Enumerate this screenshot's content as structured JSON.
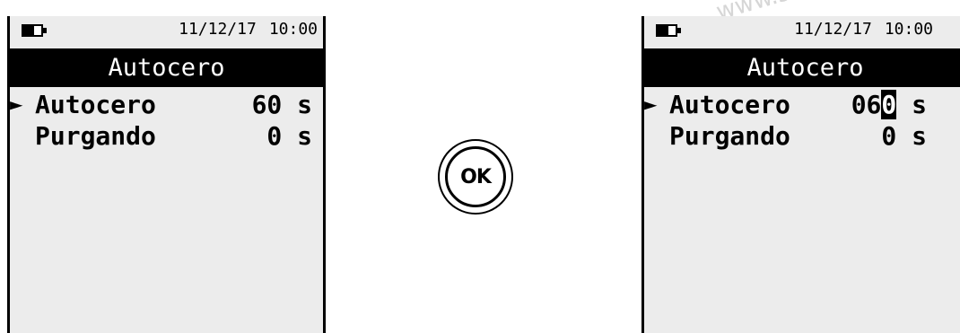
{
  "watermark": "www.s",
  "screens": {
    "left": {
      "battery_level": 0.6,
      "date": "11/12/17",
      "time": "10:00",
      "title": "Autocero",
      "cursor_glyph": "►",
      "items": [
        {
          "label": "Autocero",
          "value": "60",
          "unit": "s",
          "selected": true
        },
        {
          "label": "Purgando",
          "value": "0",
          "unit": "s",
          "selected": false
        }
      ]
    },
    "right": {
      "battery_level": 0.6,
      "date": "11/12/17",
      "time": "10:00",
      "title": "Autocero",
      "cursor_glyph": "►",
      "items": [
        {
          "label": "Autocero",
          "value_prefix": "06",
          "value_editing_digit": "0",
          "unit": "s",
          "selected": true
        },
        {
          "label": "Purgando",
          "value": "0",
          "unit": "s",
          "selected": false
        }
      ]
    }
  },
  "ok_button": {
    "label": "OK"
  }
}
